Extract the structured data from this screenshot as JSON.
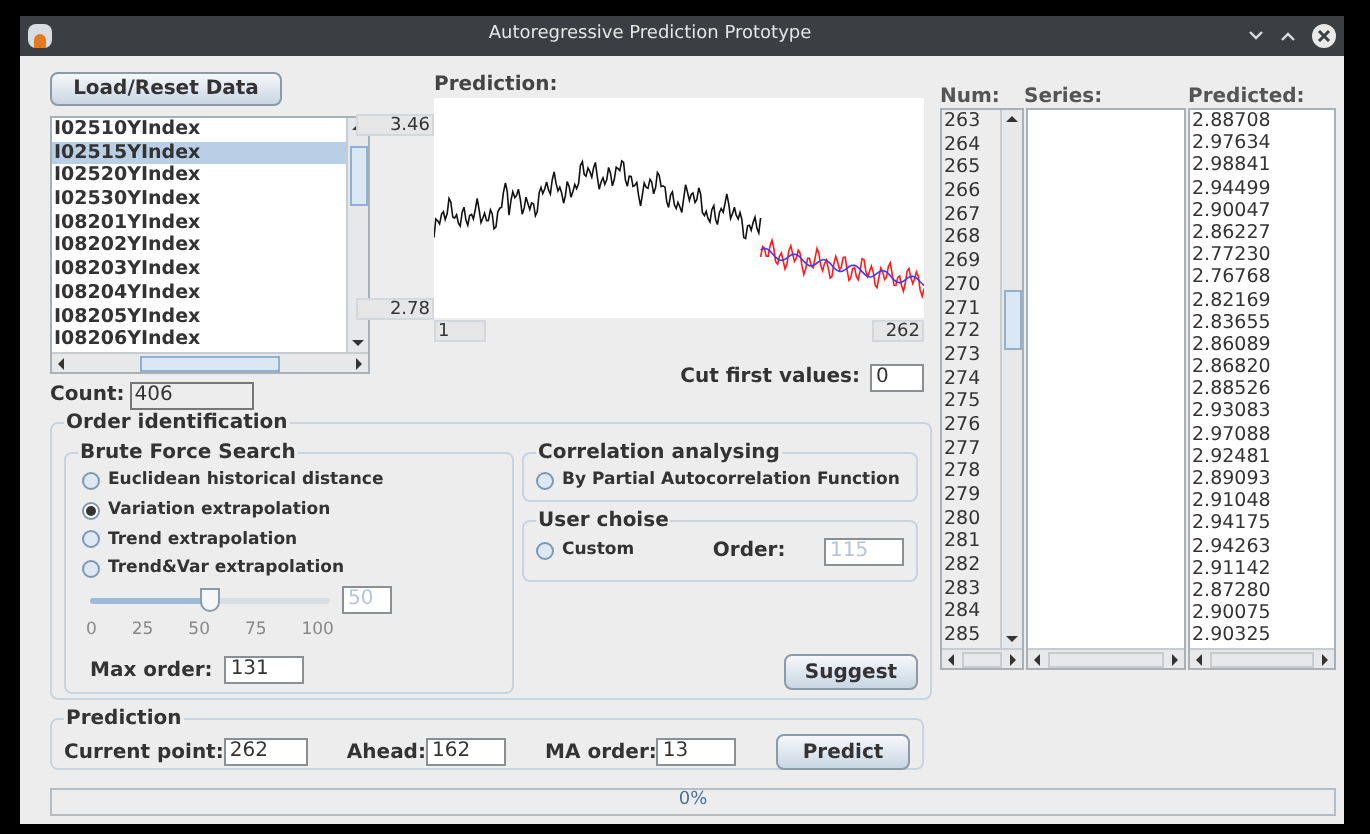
{
  "window": {
    "title": "Autoregressive Prediction Prototype"
  },
  "load_button": "Load/Reset Data",
  "series_list": {
    "items": [
      {
        "label": "I02510YIndex",
        "selected": false
      },
      {
        "label": "I02515YIndex",
        "selected": true
      },
      {
        "label": "I02520YIndex",
        "selected": false
      },
      {
        "label": "I02530YIndex",
        "selected": false
      },
      {
        "label": "I08201YIndex",
        "selected": false
      },
      {
        "label": "I08202YIndex",
        "selected": false
      },
      {
        "label": "I08203YIndex",
        "selected": false
      },
      {
        "label": "I08204YIndex",
        "selected": false
      },
      {
        "label": "I08205YIndex",
        "selected": false
      },
      {
        "label": "I08206YIndex",
        "selected": false
      }
    ],
    "count_label": "Count:",
    "count": "406"
  },
  "prediction_chart": {
    "title": "Prediction:",
    "y_max": "3.46",
    "y_min": "2.78",
    "x_start": "1",
    "x_end": "262"
  },
  "cut_first": {
    "label": "Cut first values:",
    "value": "0"
  },
  "order_identification": {
    "title": "Order identification",
    "brute_force": {
      "title": "Brute Force Search",
      "options": [
        {
          "label": "Euclidean historical distance",
          "selected": false
        },
        {
          "label": "Variation extrapolation",
          "selected": true
        },
        {
          "label": "Trend extrapolation",
          "selected": false
        },
        {
          "label": "Trend&Var extrapolation",
          "selected": false
        }
      ],
      "slider": {
        "level": 0.5,
        "value": "50",
        "tick_labels": [
          "0",
          "25",
          "50",
          "75",
          "100"
        ]
      },
      "max_order": {
        "label": "Max order:",
        "value": "131"
      }
    },
    "correlation": {
      "title": "Correlation analysing",
      "option": {
        "label": "By Partial Autocorrelation Function",
        "selected": false
      }
    },
    "user_choice": {
      "title": "User choise",
      "option": {
        "label": "Custom",
        "selected": false
      },
      "order_label": "Order:",
      "order_value": "115",
      "order_disabled": true
    },
    "suggest_button": "Suggest"
  },
  "prediction": {
    "title": "Prediction",
    "current_point": {
      "label": "Current point:",
      "value": "262"
    },
    "ahead": {
      "label": "Ahead:",
      "value": "162"
    },
    "ma_order": {
      "label": "MA order:",
      "value": "13"
    },
    "predict_button": "Predict"
  },
  "results": {
    "columns": [
      "Num:",
      "Series:",
      "Predicted:"
    ],
    "num": [
      "263",
      "264",
      "265",
      "266",
      "267",
      "268",
      "269",
      "270",
      "271",
      "272",
      "273",
      "274",
      "275",
      "276",
      "277",
      "278",
      "279",
      "280",
      "281",
      "282",
      "283",
      "284",
      "285"
    ],
    "predicted": [
      "2.88708",
      "2.97634",
      "2.98841",
      "2.94499",
      "2.90047",
      "2.86227",
      "2.77230",
      "2.76768",
      "2.82169",
      "2.83655",
      "2.86089",
      "2.86820",
      "2.88526",
      "2.93083",
      "2.97088",
      "2.92481",
      "2.89093",
      "2.91048",
      "2.94175",
      "2.94263",
      "2.91142",
      "2.87280",
      "2.90075",
      "2.90325"
    ]
  },
  "progress": {
    "level": 0,
    "text": "0%"
  }
}
